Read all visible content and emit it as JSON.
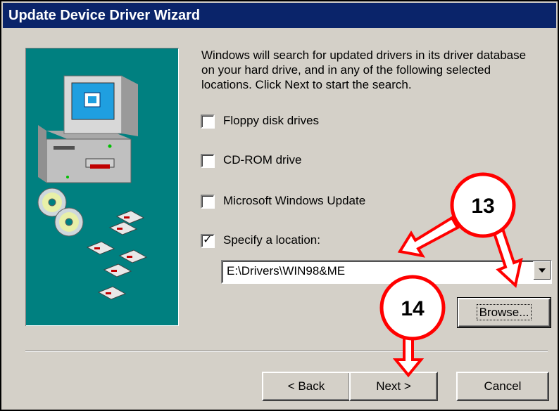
{
  "window": {
    "title": "Update Device Driver Wizard"
  },
  "intro_text": "Windows will search for updated drivers in its driver database on your hard drive, and in any of the following selected locations. Click Next to start the search.",
  "options": [
    {
      "label": "Floppy disk drives",
      "checked": false
    },
    {
      "label": "CD-ROM drive",
      "checked": false
    },
    {
      "label": "Microsoft Windows Update",
      "checked": false
    },
    {
      "label": "Specify a location:",
      "checked": true
    }
  ],
  "location": {
    "value": "E:\\Drivers\\WIN98&ME"
  },
  "buttons": {
    "browse": "Browse...",
    "back": "< Back",
    "next": "Next >",
    "cancel": "Cancel"
  },
  "callouts": {
    "first": "13",
    "second": "14"
  },
  "colors": {
    "title_bar": "#0a246a",
    "panel": "#008080",
    "face": "#d4d0c8",
    "callout_arrow": "#ff0000"
  },
  "icons": [
    "computer-icon",
    "cd-icon",
    "floppy-disk-icon",
    "checkmark-icon",
    "dropdown-arrow-icon",
    "callout-arrow-icon"
  ]
}
